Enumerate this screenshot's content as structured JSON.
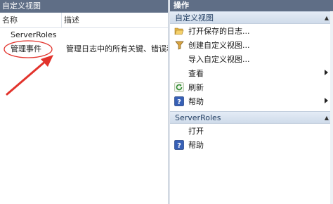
{
  "left": {
    "title": "自定义视图",
    "columns": {
      "name": "名称",
      "desc": "描述"
    },
    "group_label": "ServerRoles",
    "rows": [
      {
        "name": "管理事件",
        "desc": "管理日志中的所有关键、错误和警"
      }
    ]
  },
  "right": {
    "title": "操作",
    "sections": [
      {
        "header": "自定义视图",
        "items": [
          {
            "label": "打开保存的日志...",
            "icon": "folder-open-icon"
          },
          {
            "label": "创建自定义视图...",
            "icon": "filter-icon"
          },
          {
            "label": "导入自定义视图...",
            "icon": ""
          },
          {
            "label": "查看",
            "icon": "",
            "submenu": true
          },
          {
            "label": "刷新",
            "icon": "refresh-icon"
          },
          {
            "label": "帮助",
            "icon": "help-icon",
            "submenu": true
          }
        ]
      },
      {
        "header": "ServerRoles",
        "items": [
          {
            "label": "打开",
            "icon": ""
          },
          {
            "label": "帮助",
            "icon": "help-icon"
          }
        ]
      }
    ]
  },
  "colors": {
    "title_bar": "#5f6e86",
    "annotation_red": "#e2332c",
    "section_text": "#1e3a5f"
  }
}
